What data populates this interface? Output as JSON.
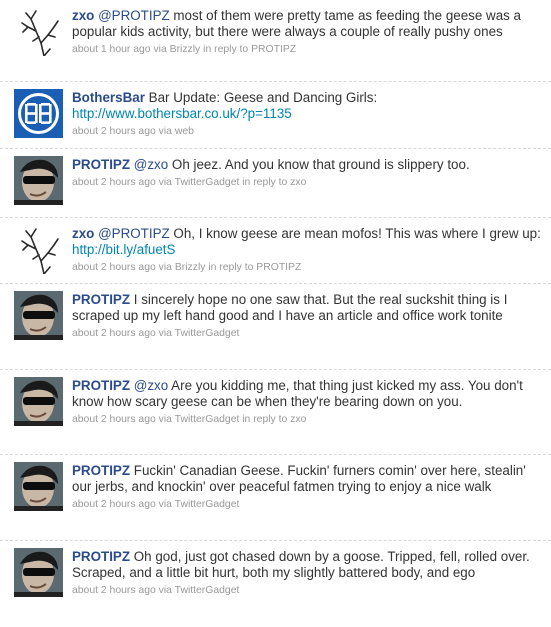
{
  "tweets": [
    {
      "user": "zxo",
      "avatar": "tree-icon",
      "mention": "@PROTIPZ",
      "text": " most of them were pretty tame as feeding the geese was a popular kids activity, but there were always a couple of really pushy ones",
      "time": "about 1 hour ago",
      "via_label": "via",
      "source": "Brizzly",
      "reply_label": "in reply to",
      "reply_to": "PROTIPZ"
    },
    {
      "user": "BothersBar",
      "avatar": "bb-logo-icon",
      "text": "Bar Update: Geese and Dancing Girls:",
      "link": "http://www.bothersbar.co.uk/?p=1135",
      "time": "about 2 hours ago",
      "via_label": "via",
      "source": "web"
    },
    {
      "user": "PROTIPZ",
      "avatar": "sunglasses-man-icon",
      "mention": "@zxo",
      "text": " Oh jeez. And you know that ground is slippery too.",
      "time": "about 2 hours ago",
      "via_label": "via",
      "source": "TwitterGadget",
      "reply_label": "in reply to",
      "reply_to": "zxo"
    },
    {
      "user": "zxo",
      "avatar": "tree-icon",
      "mention": "@PROTIPZ",
      "text": " Oh, I know geese are mean mofos! This was where I grew up:",
      "link": "http://bit.ly/afuetS",
      "time": "about 2 hours ago",
      "via_label": "via",
      "source": "Brizzly",
      "reply_label": "in reply to",
      "reply_to": "PROTIPZ"
    },
    {
      "user": "PROTIPZ",
      "avatar": "sunglasses-man-icon",
      "text": "I sincerely hope no one saw that. But the real suckshit thing is I scraped up my left hand good and I have an article and office work tonite",
      "time": "about 2 hours ago",
      "via_label": "via",
      "source": "TwitterGadget"
    },
    {
      "user": "PROTIPZ",
      "avatar": "sunglasses-man-icon",
      "mention": "@zxo",
      "text": " Are you kidding me, that thing just kicked my ass. You don't know how scary geese can be when they're bearing down on you.",
      "time": "about 2 hours ago",
      "via_label": "via",
      "source": "TwitterGadget",
      "reply_label": "in reply to",
      "reply_to": "zxo"
    },
    {
      "user": "PROTIPZ",
      "avatar": "sunglasses-man-icon",
      "text": "Fuckin' Canadian Geese. Fuckin' furners comin' over here, stealin' our jerbs, and knockin' over peaceful fatmen trying to enjoy a nice walk",
      "time": "about 2 hours ago",
      "via_label": "via",
      "source": "TwitterGadget"
    },
    {
      "user": "PROTIPZ",
      "avatar": "sunglasses-man-icon",
      "text": "Oh god, just got chased down by a goose. Tripped, fell, rolled over. Scraped, and a little bit hurt, both my slightly battered body, and ego",
      "time": "about 2 hours ago",
      "via_label": "via",
      "source": "TwitterGadget"
    }
  ]
}
